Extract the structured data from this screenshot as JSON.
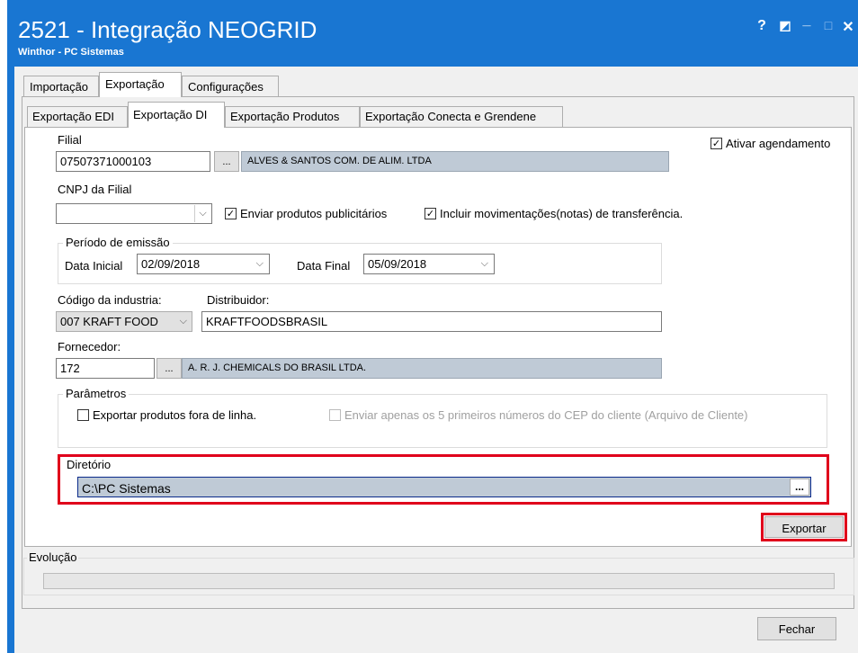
{
  "window": {
    "title": "2521 - Integração NEOGRID",
    "subtitle": "Winthor - PC Sistemas",
    "help_glyph": "?",
    "restore_glyph": "◩",
    "minimize_glyph": "_",
    "maximize_glyph": "□",
    "close_glyph": "✕"
  },
  "tabs": [
    "Importação",
    "Exportação",
    "Configurações"
  ],
  "subtabs": [
    "Exportação EDI",
    "Exportação DI",
    "Exportação Produtos",
    "Exportação Conecta e Grendene"
  ],
  "form": {
    "filial_label": "Filial",
    "filial_code": "07507371000103",
    "filial_name": "ALVES & SANTOS COM. DE ALIM. LTDA",
    "lookup_dots": "...",
    "ativar_agendamento": "Ativar agendamento",
    "cnpj_label": "CNPJ da Filial",
    "cnpj_value": "",
    "enviar_publicitarios": "Enviar produtos publicitários",
    "incluir_transferencia": "Incluir movimentações(notas) de transferência.",
    "periodo_title": "Período de emissão",
    "data_inicial_label": "Data Inicial",
    "data_inicial": "02/09/2018",
    "data_final_label": "Data Final",
    "data_final": "05/09/2018",
    "codigo_industria_label": "Código da industria:",
    "codigo_industria": "007 KRAFT FOOD",
    "distribuidor_label": "Distribuidor:",
    "distribuidor": "KRAFTFOODSBRASIL",
    "fornecedor_label": "Fornecedor:",
    "fornecedor_code": "172",
    "fornecedor_name": "A. R. J. CHEMICALS DO BRASIL LTDA.",
    "parametros_title": "Parâmetros",
    "exportar_fora_linha": "Exportar produtos fora de linha.",
    "enviar_cep": "Enviar apenas os 5 primeiros números do CEP do cliente (Arquivo de Cliente)",
    "diretorio_title": "Diretório",
    "diretorio_value": "C:\\PC Sistemas",
    "diretorio_dots": "...",
    "exportar_button": "Exportar",
    "evolucao_title": "Evolução",
    "fechar_button": "Fechar",
    "check_glyph": "✓",
    "chevron_glyph": "⌵"
  },
  "colors": {
    "titlebar": "#1976d2",
    "highlight": "#e0001b",
    "readonly": "#bfcad6"
  }
}
